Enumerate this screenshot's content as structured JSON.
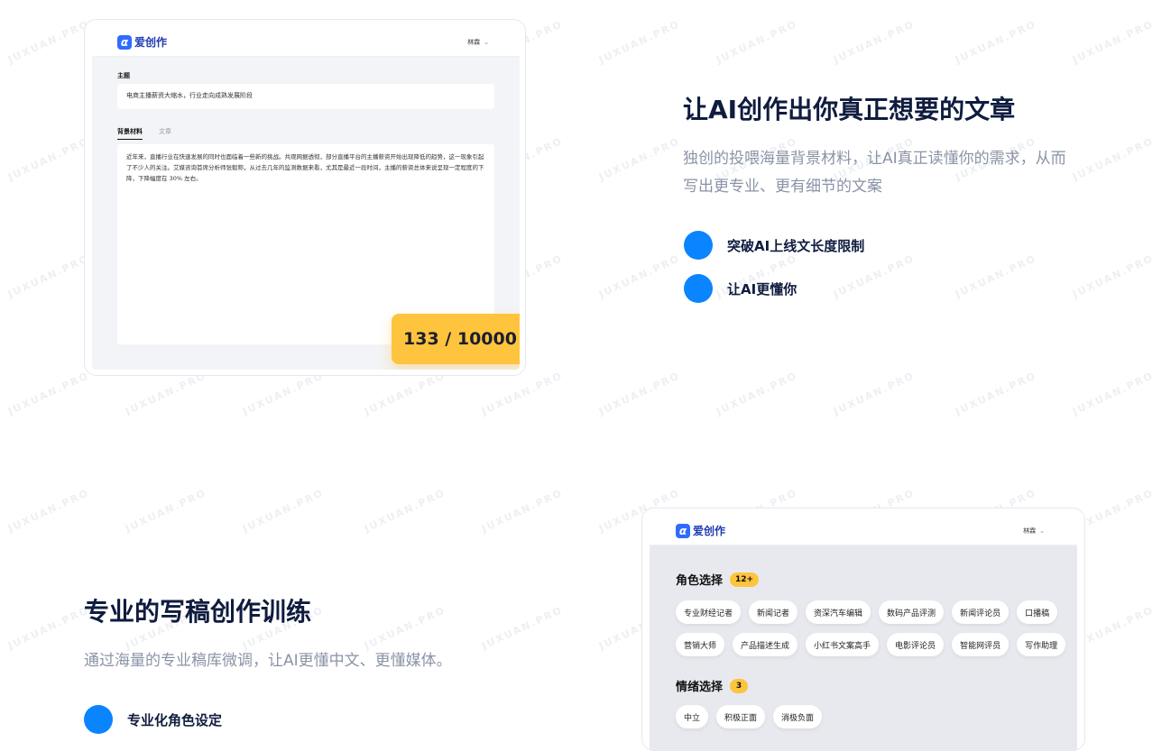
{
  "watermark": "JUXUAN.PRO",
  "card1": {
    "brand": "爱创作",
    "user": "林霖",
    "topic_label": "主题",
    "topic_value": "电商主播薪资大缩水，行业走向成熟发展阶段",
    "tabs": [
      "背景材料",
      "文章"
    ],
    "body": "近年来，直播行业在快速发展的同时也面临着一些新的挑战。共观网据透彻，部分直播平台的主播薪资开始出现降低的趋势，这一现象引起了不少人的关注。艾媒咨询首席分析师张毅称，从过去几年的监测数据来看，尤其是最近一段时间，主播的薪资总体来说呈现一定程度的下降，下降幅度在 30% 左右。",
    "counter": "133 / 10000"
  },
  "section1": {
    "title": "让AI创作出你真正想要的文章",
    "desc": "独创的投喂海量背景材料，让AI真正读懂你的需求，从而写出更专业、更有细节的文案",
    "features": [
      "突破AI上线文长度限制",
      "让AI更懂你"
    ]
  },
  "section2": {
    "title": "专业的写稿创作训练",
    "desc": "通过海量的专业稿库微调，让AI更懂中文、更懂媒体。",
    "features": [
      "专业化角色设定"
    ]
  },
  "card2": {
    "brand": "爱创作",
    "user": "林霖",
    "role_title": "角色选择",
    "role_badge": "12+",
    "roles": [
      "专业财经记者",
      "新闻记者",
      "资深汽车编辑",
      "数码产品评测",
      "新闻评论员",
      "口播稿",
      "营销大师",
      "产品描述生成",
      "小红书文案高手",
      "电影评论员",
      "智能网评员",
      "写作助理"
    ],
    "emotion_title": "情绪选择",
    "emotion_badge": "3",
    "emotions": [
      "中立",
      "积极正面",
      "消极负面"
    ]
  },
  "colors": {
    "accent": "#0a84ff",
    "counter_bg": "#ffc43d",
    "brand": "#2f6bff",
    "heading": "#0f1c3f",
    "muted": "#8a93a6"
  }
}
